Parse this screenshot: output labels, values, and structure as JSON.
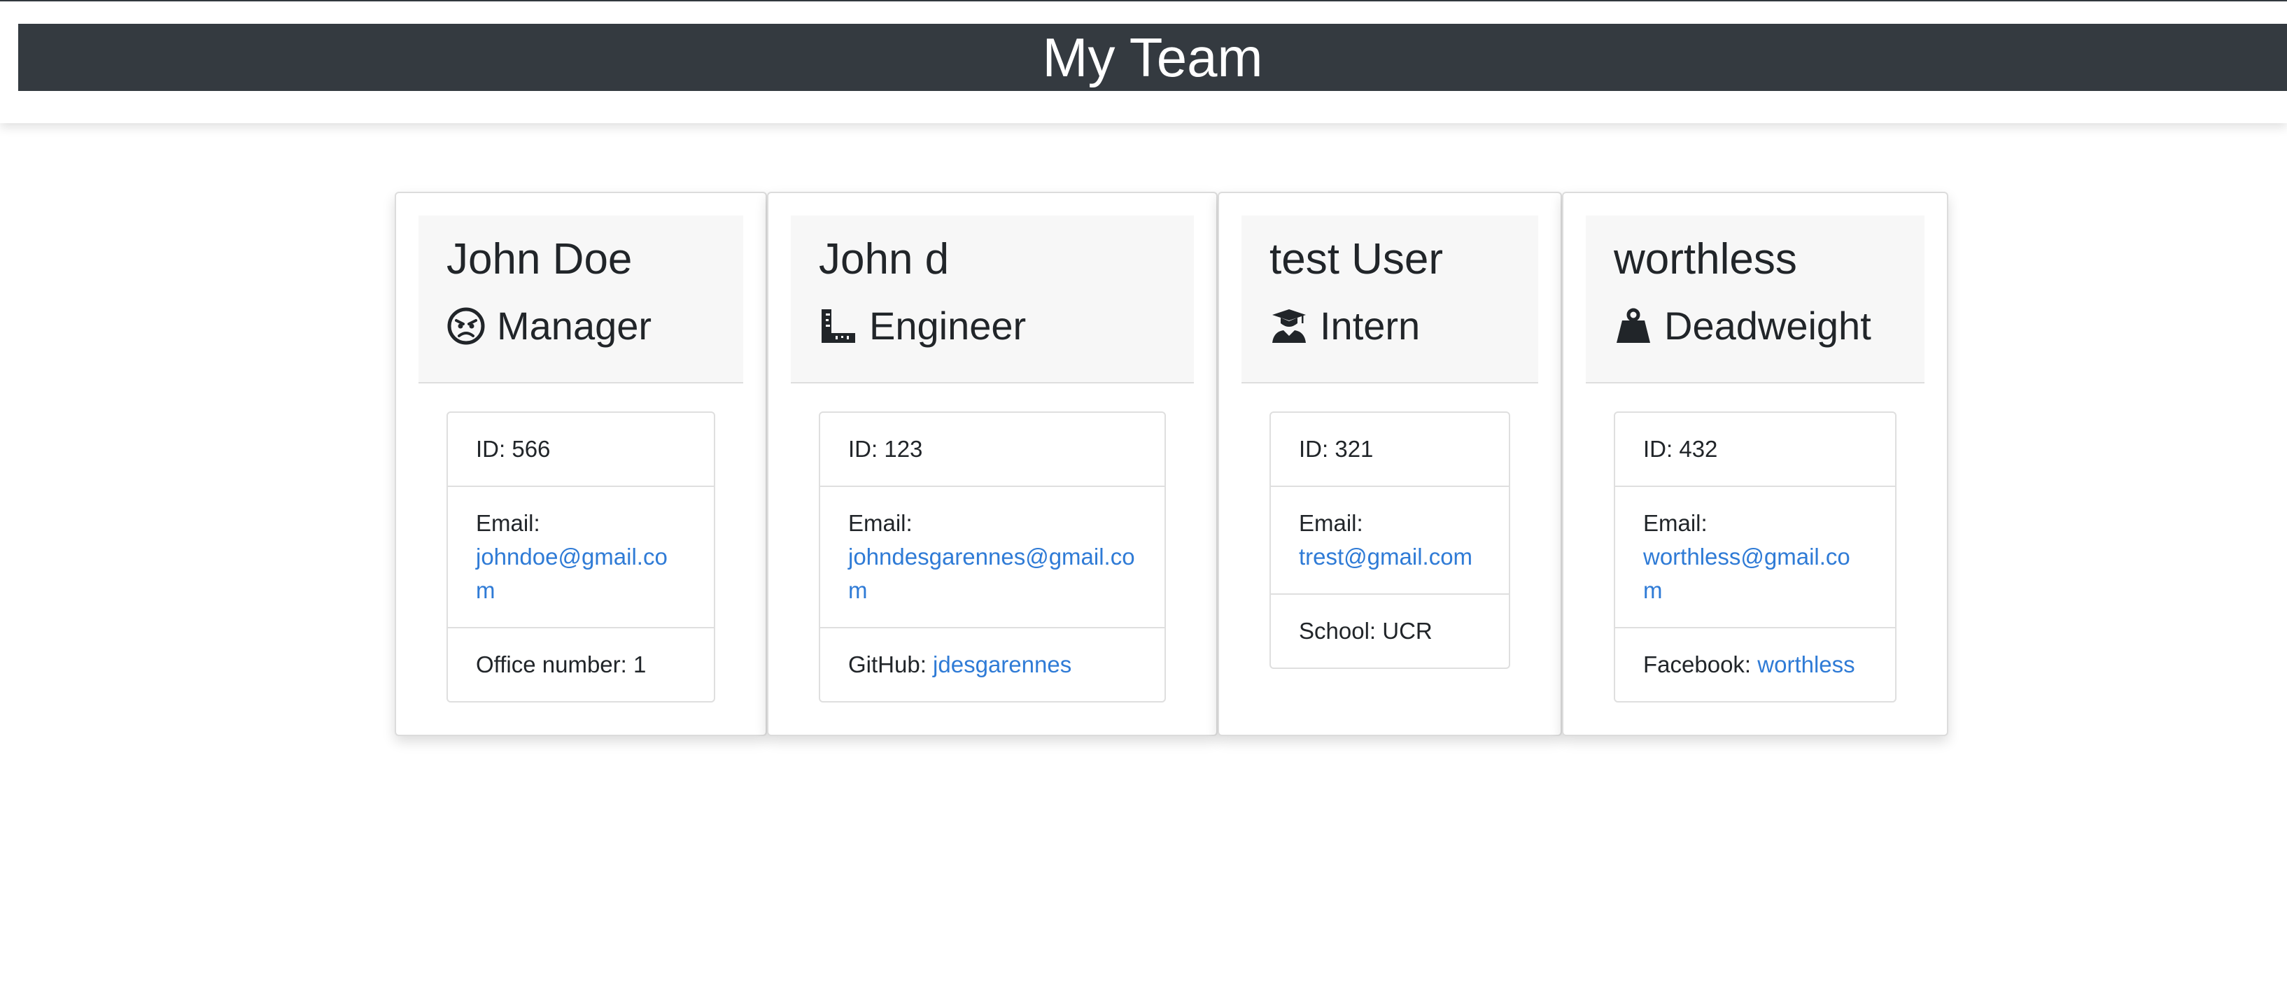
{
  "header": {
    "title": "My Team"
  },
  "employees": [
    {
      "name": "John Doe",
      "role": "Manager",
      "icon": "angry-face-icon",
      "id_label": "ID: 566",
      "email_label": "Email:",
      "email": "johndoe@gmail.com",
      "extra_label": "Office number: 1",
      "extra_link": ""
    },
    {
      "name": "John d",
      "role": "Engineer",
      "icon": "ruler-combined-icon",
      "id_label": "ID: 123",
      "email_label": "Email:",
      "email": "johndesgarennes@gmail.com",
      "extra_label": "GitHub:",
      "extra_link": "jdesgarennes"
    },
    {
      "name": "test User",
      "role": "Intern",
      "icon": "graduate-icon",
      "id_label": "ID: 321",
      "email_label": "Email:",
      "email": "trest@gmail.com",
      "extra_label": "School: UCR",
      "extra_link": ""
    },
    {
      "name": "worthless",
      "role": "Deadweight",
      "icon": "weight-hanging-icon",
      "id_label": "ID: 432",
      "email_label": "Email:",
      "email": "worthless@gmail.com",
      "extra_label": "Facebook:",
      "extra_link": "worthless"
    }
  ],
  "colors": {
    "header_bg": "#343a40",
    "link": "#2f7bd6",
    "card_header_bg": "#f7f7f7"
  }
}
